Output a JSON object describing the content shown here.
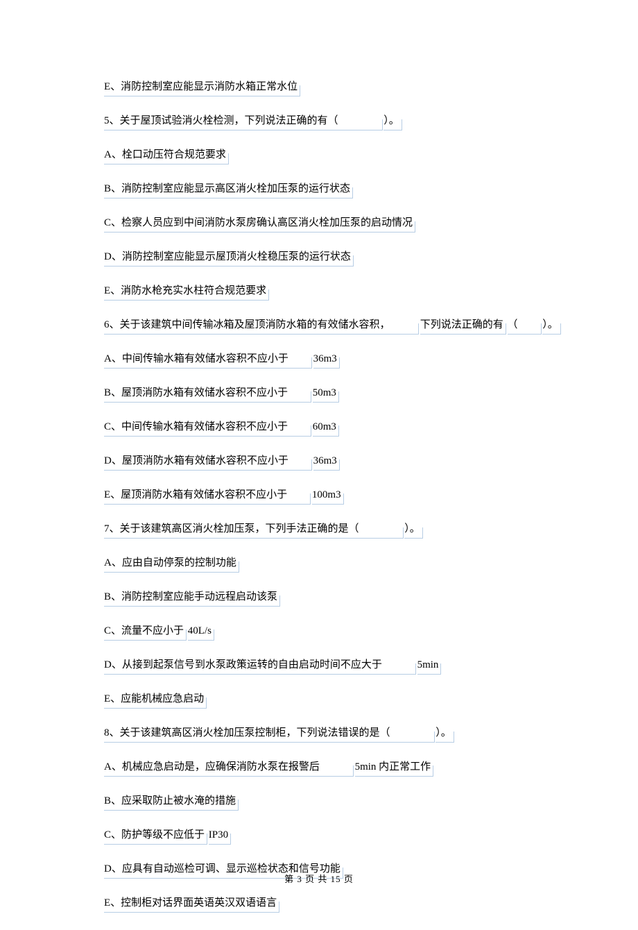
{
  "lines": [
    {
      "groups": [
        "E、消防控制室应能显示消防水箱正常水位"
      ]
    },
    {
      "groups": [
        "5、关于屋顶试验消火栓检测，下列说法正确的有（　　　　",
        "）。"
      ]
    },
    {
      "groups": [
        "A、栓口动压符合规范要求"
      ]
    },
    {
      "groups": [
        "B、消防控制室应能显示高区消火栓加压泵的运行状态"
      ]
    },
    {
      "groups": [
        "C、检察人员应到中间消防水泵房确认高区消火栓加压泵的启动情况"
      ]
    },
    {
      "groups": [
        "D、消防控制室应能显示屋顶消火栓稳压泵的运行状态"
      ]
    },
    {
      "groups": [
        "E、消防水枪充实水柱符合规范要求"
      ]
    },
    {
      "groups": [
        "6、关于该建筑中间传输冰箱及屋顶消防水箱的有效储水容积，　　　",
        "下列说法正确的有",
        "（　　",
        "）。"
      ]
    },
    {
      "groups": [
        "A、中间传输水箱有效储水容积不应小于　　",
        "36m3"
      ]
    },
    {
      "groups": [
        "B、屋顶消防水箱有效储水容积不应小于　　",
        "50m3"
      ]
    },
    {
      "groups": [
        "C、中间传输水箱有效储水容积不应小于　　",
        "60m3"
      ]
    },
    {
      "groups": [
        "D、屋顶消防水箱有效储水容积不应小于　　",
        "36m3"
      ]
    },
    {
      "groups": [
        "E、屋顶消防水箱有效储水容积不应小于　　",
        "100m3"
      ]
    },
    {
      "groups": [
        "7、关于该建筑高区消火栓加压泵，下列手法正确的是（　　　　",
        "）。"
      ]
    },
    {
      "groups": [
        "A、应由自动停泵的控制功能"
      ]
    },
    {
      "groups": [
        "B、消防控制室应能手动远程启动该泵"
      ]
    },
    {
      "groups": [
        "C、流量不应小于",
        " 40L/s"
      ]
    },
    {
      "groups": [
        "D、从接到起泵信号到水泵政策运转的自由启动时间不应大于　　　",
        "5min"
      ]
    },
    {
      "groups": [
        "E、应能机械应急启动"
      ]
    },
    {
      "groups": [
        "8、关于该建筑高区消火栓加压泵控制柜，下列说法错误的是（　　　　",
        "）。"
      ]
    },
    {
      "groups": [
        "A、机械应急启动是，应确保消防水泵在报警后　　　",
        "5min 内正常工作"
      ]
    },
    {
      "groups": [
        "B、应采取防止被水淹的措施"
      ]
    },
    {
      "groups": [
        "C、防护等级不应低于",
        " IP30"
      ]
    },
    {
      "groups": [
        "D、应具有自动巡检可调、显示巡检状态和信号功能"
      ]
    },
    {
      "groups": [
        "E、控制柜对话界面英语英汉双语语言"
      ]
    }
  ],
  "footer": {
    "prefix": "第",
    "page": "3",
    "middle": "页 共",
    "total": "15",
    "suffix": "页"
  }
}
